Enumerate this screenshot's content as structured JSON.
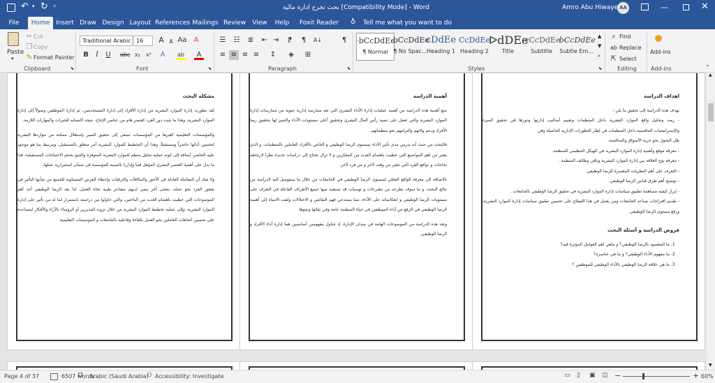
{
  "titlebar": {
    "document_title": "بحث تخرج ادارة مالية [Compatibility Mode] - Word",
    "user_name": "Amro Abu Hiwayej",
    "user_initials": "AA",
    "icons": [
      "save-icon",
      "undo-icon",
      "redo-icon",
      "customize-quick-access-icon",
      "ribbon-display-options-icon",
      "minimize-icon",
      "maximize-icon",
      "close-icon"
    ]
  },
  "ribbon_tabs": [
    "File",
    "Home",
    "Insert",
    "Draw",
    "Design",
    "Layout",
    "References",
    "Mailings",
    "Review",
    "View",
    "Help",
    "Foxit Reader PDF"
  ],
  "active_tab": "Home",
  "tell_me": "Tell me what you want to do",
  "clipboard": {
    "paste": "Paste",
    "cut": "Cut",
    "copy": "Copy",
    "format_painter": "Format Painter",
    "label": "Clipboard"
  },
  "font": {
    "name": "Traditional Arabic",
    "size": "16",
    "label": "Font",
    "bold": "B",
    "italic": "I",
    "underline": "U",
    "strike": "abc",
    "subscript": "x₂",
    "superscript": "x²",
    "grow": "A",
    "shrink": "A",
    "case": "Aa",
    "clear": "A",
    "effects": "A",
    "highlight": "ab",
    "color": "A"
  },
  "paragraph": {
    "label": "Paragraph",
    "show_hide": "¶"
  },
  "styles": {
    "label": "Styles",
    "items": [
      {
        "preview": "ᐧbCcDdEe",
        "name": "¶ Normal"
      },
      {
        "preview": "ᐧbCcDdEe",
        "name": "¶ No Spac..."
      },
      {
        "preview": "cDdEe",
        "name": "Heading 1"
      },
      {
        "preview": "CcDdEe",
        "name": "Heading 2"
      },
      {
        "preview": "ᐅdDEe",
        "name": "Title"
      },
      {
        "preview": "ᐧcCcDdEe",
        "name": "Subtitle"
      },
      {
        "preview": "ᐧbCcDdEe",
        "name": "Subtle Em..."
      }
    ]
  },
  "editing": {
    "label": "Editing",
    "find": "Find",
    "replace": "Replace",
    "select": "Select"
  },
  "addins": {
    "label": "Add-ins",
    "button": "Add-ins"
  },
  "pages": [
    {
      "heading": "مشكلة البحث",
      "paragraphs": [
        "لقد تطورت إدارة الموارد البشرية من إدارة الأفراد إلى إدارة المستخدمين، ثم إدارة الموظفين وصولاً إلى إدارة الموارد البشرية، وهذا ما يثبت دور الفرد كعنصر هام من عناصر الإنتاج، نتيجة اكتسابه للخبرات والمهارات اللازمة.",
        "والمؤسسات التعليمية كغيرها من المؤسسات تسعى إلى تحقيق التميز بإستغلال ممكنة من مواردها البشرية لتحسين أدائها حاضراً ومستقبلاً، وهذا أن التخطيط للموارد البشرية أمر متعلق بالمستقبل، ومرتبط بما هو موجود عليه الحاضر، إضافة إلى كونه عملية تحليل منظم للموارد البشرية المتوفرة والتنبؤ بحجم الاحتياجات المستقبلية، هذا ما يدل على أهمية العنصر البشري المؤهل فنيا وإداريا بالنسبة للمؤسسة في ضمان استمرارية عملها.",
        "ولا شك أن المعاملة العادلة في الأجور والمكافآت والترقيات وإعطاء الفرص المتساوية للجميع من شأنها التأثير في شعور الفرد نحو عمله، بمعنى آخر ينمي لديهم مشاعر طيبة تجاه العمل، لذا يعد الرضا الوظيفي أحد أهم الموضوعات التي حظيت باهتمام العديد من الباحثين، والتي حاولوا من دراسته باستمرار لما له من تأثير على إدارة الموارد البشرية، وإلى عملية تخطيط الموارد البشرية من خلال تزويد المديرين أو الرؤساء بالآراء والأفكار لمساعدة على تحسين اتجاهات العاملين نحو العمل بكفاءة وفاعلية بالجامعات و المؤسسات التعليمية"
      ],
      "list": []
    },
    {
      "heading": "أهمية الدراسة",
      "paragraphs": [
        "تنبع أهمية هذه الدراسة من أهمية عمليات إدارة الأداء البشري التي تعد ممارسة إدارية حيوية من ممارسات إدارة الموارد البشرية والتي تعمل على تنمية رأس المال البشري وتحقيق أعلى مستويات الأداء والتميز لها بتحقيق رضا الأفراد ودعم ولائهم والتزامهم نحو منظماتهم.",
        "فالبحث من حيث أنه يدرس مدى تأثير الأداء بمستوى الرضا الوظيفي و الخاص بالأفراد العاملين بالمنظمات، و الذي يعتبر من اهم المواضيع التي حظيت باهتمام العديد من المفكرين و لا تزال تحتاج إلى دراسات جديدة نظرا لارتباطه بحاجات و دوافع الفرد التي تتغير من وقت لآخر و من فرد لآخر.",
        "بالاضافة الى معرفة الواقع الفعلي لمستوى الرضا الوظيفي في الجامعات من خلال ما ستتوصل اليه الدراسة من نتائج البحث، و ما سوف تطرحه من مقترحات و توصيات قد تستفيد منها جميع الأطراف الفاعلة في التعرف على مستويات الرضا الوظيفي و انعكاساته على الأداء، مما يستدعي فهم النقائص و الاختلالات ولفت الانتباه إلى أهمية الرضا الوظيفي في الرفع من أداء الموظفين في حياة المنظمة عامة وفي بقائها ونموها",
        "وتعد هذه الدراسة من الموضوعات الهامة في ميدان الإدارة، إذ تتناول مفهومين أساسيين هما إدارة أداء الأفراد و الرضا الوظيفي."
      ],
      "list": []
    },
    {
      "heading": "اهداف الدراسة",
      "paragraphs": [
        "تهدف هذه الدراسة إلى تحقيق ما يلي :",
        "- رصد وتحليل واقع الموارد البشرية داخل المنظمات وتقييم أساليب إدارتها ودورها في تحقيق الميزة والإستراتيجيات التنافسية داخل المنظمات في إطار التطورات الإدارية الحاصلة وفي",
        "ظل التحول نحو حرية الأسواق والمنافسة.",
        "- معرفة موقع وأهمية إدارة الموارد البشرية في الهيكل التنظيمي للمنظمة.",
        "- معرفة نوع العلاقة بين إدارة الموارد البشرية وباقي وظائف المنظمة .",
        "- التعرف على أهم النظريات المفسرة للرضا الوظيفي.",
        "- توضيح أهم طرق قياس الرضا الوظيفي.",
        "- إبراز كيفية مساهمة تطبيق سياسات إدارة الموارد البشرية في تحقيق الرضا الوظيفي بالجامعات .",
        "- تقديم اقتراحات تساعد الجامعات ومن يعمل في هذا القطاع على تحسين تطبيق سياسات إدارة الموارد البشرية، ورفع مستوى الرضا الوظيفي."
      ],
      "subheading": "فروض الدراسة و أسئلة البحث",
      "list": [
        "ما المقصود بالرضا الوظيفي؟ و ماهي اهم العوامل المؤثرة فيه؟",
        "ما مفهوم الأداء الوظيفي؟ و ما هي عناصره؟",
        "ما هي علاقة الرضا الوظيفي بالأداء الوظيفي للموظفين ؟"
      ]
    }
  ],
  "status": {
    "page": "Page 4 of 37",
    "words": "6507 words",
    "language": "Arabic (Saudi Arabia)",
    "accessibility": "Accessibility: Investigate",
    "zoom": "60%",
    "zoom_level": 0.6
  }
}
